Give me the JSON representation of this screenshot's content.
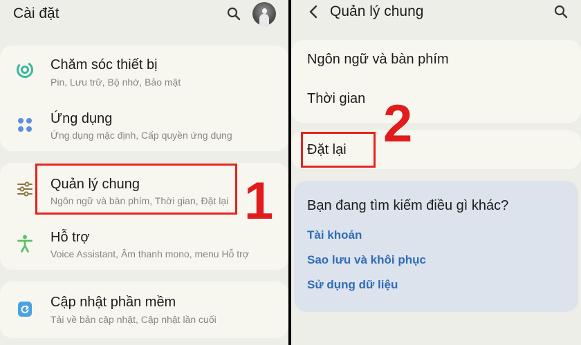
{
  "left": {
    "title": "Cài đặt",
    "items": [
      {
        "title": "Chăm sóc thiết bị",
        "subtitle": "Pin, Lưu trữ, Bộ nhớ, Bảo mật",
        "icon": "device-care-icon",
        "color": "#3bb89c"
      },
      {
        "title": "Ứng dụng",
        "subtitle": "Ứng dụng mặc định, Cấp quyền ứng dụng",
        "icon": "apps-icon",
        "color": "#5b8fde"
      },
      {
        "title": "Quản lý chung",
        "subtitle": "Ngôn ngữ và bàn phím, Thời gian, Đặt lại",
        "icon": "sliders-icon",
        "color": "#8a7340"
      },
      {
        "title": "Hỗ trợ",
        "subtitle": "Voice Assistant, Âm thanh mono, menu Hỗ trợ",
        "icon": "accessibility-icon",
        "color": "#5bbf6a"
      },
      {
        "title": "Cập nhật phần mềm",
        "subtitle": "Tải về bản cập nhật, Cập nhật lần cuối",
        "icon": "software-update-icon",
        "color": "#4aa3e0"
      }
    ]
  },
  "right": {
    "title": "Quản lý chung",
    "items": [
      "Ngôn ngữ và bàn phím",
      "Thời gian",
      "Đặt lại"
    ],
    "search_prompt": "Bạn đang tìm kiếm điều gì khác?",
    "links": [
      "Tài khoản",
      "Sao lưu và khôi phục",
      "Sử dụng dữ liệu"
    ]
  },
  "annotations": {
    "step1": "1",
    "step2": "2",
    "color": "#e4231c"
  },
  "colors": {
    "link": "#2f6cb8",
    "background": "#eeeee8",
    "card": "#f8f7ef",
    "search_card": "#dde3ec"
  }
}
